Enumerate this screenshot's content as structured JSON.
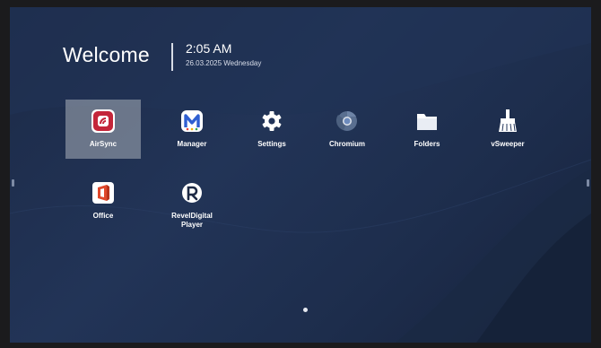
{
  "header": {
    "welcome_text": "Welcome",
    "time": "2:05 AM",
    "date": "26.03.2025 Wednesday"
  },
  "apps": [
    {
      "label": "AirSync",
      "icon": "airsync-icon",
      "selected": true
    },
    {
      "label": "Manager",
      "icon": "manager-icon"
    },
    {
      "label": "Settings",
      "icon": "gear-icon"
    },
    {
      "label": "Chromium",
      "icon": "chromium-icon"
    },
    {
      "label": "Folders",
      "icon": "folder-icon"
    },
    {
      "label": "vSweeper",
      "icon": "broom-icon"
    },
    {
      "label": "Office",
      "icon": "office-icon"
    },
    {
      "label": "RevelDigital Player",
      "label_line1": "RevelDigital",
      "label_line2": "Player",
      "icon": "reveldigital-icon"
    }
  ],
  "pager": {
    "pages": 1,
    "current": 1
  },
  "colors": {
    "background": "#1f3152",
    "airsync_red": "#c4263a",
    "manager_blue": "#2f5fd1",
    "office_orange": "#e0482b"
  }
}
